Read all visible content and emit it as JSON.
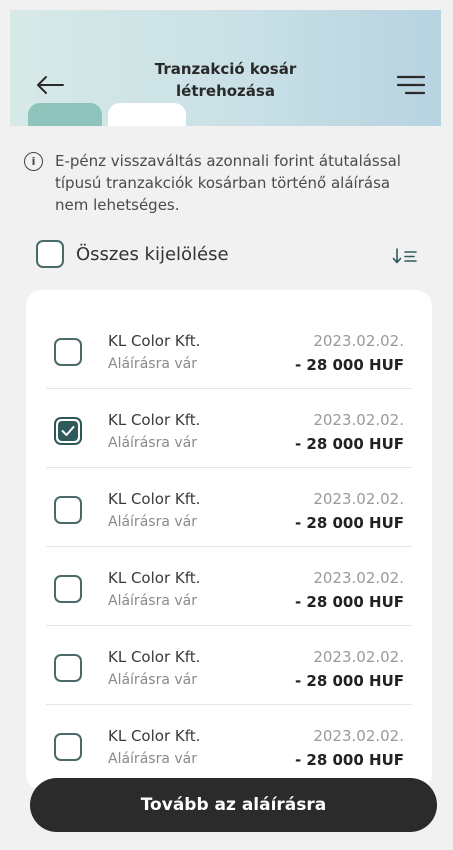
{
  "header": {
    "title_line1": "Tranzakció kosár",
    "title_line2": "létrehozása",
    "back_icon": "arrow-left-icon",
    "menu_icon": "hamburger-menu-icon"
  },
  "info": {
    "icon": "i",
    "text": "E-pénz visszaváltás azonnali forint átutalással típusú tranzakciók kosárban történő aláírása nem lehetséges."
  },
  "select_all": {
    "label": "Összes kijelölése",
    "checked": false
  },
  "sort_icon": "sort-icon",
  "transactions": [
    {
      "name": "KL Color Kft.",
      "status": "Aláírásra vár",
      "date": "2023.02.02.",
      "amount": "- 28 000 HUF",
      "checked": false
    },
    {
      "name": "KL Color Kft.",
      "status": "Aláírásra vár",
      "date": "2023.02.02.",
      "amount": "- 28 000 HUF",
      "checked": true
    },
    {
      "name": "KL Color Kft.",
      "status": "Aláírásra vár",
      "date": "2023.02.02.",
      "amount": "- 28 000 HUF",
      "checked": false
    },
    {
      "name": "KL Color Kft.",
      "status": "Aláírásra vár",
      "date": "2023.02.02.",
      "amount": "- 28 000 HUF",
      "checked": false
    },
    {
      "name": "KL Color Kft.",
      "status": "Aláírásra vár",
      "date": "2023.02.02.",
      "amount": "- 28 000 HUF",
      "checked": false
    },
    {
      "name": "KL Color Kft.",
      "status": "Aláírásra vár",
      "date": "2023.02.02.",
      "amount": "- 28 000 HUF",
      "checked": false
    }
  ],
  "cta": {
    "label": "Tovább az aláírásra"
  },
  "colors": {
    "accent": "#2f5a5a",
    "header_gradient_start": "#d7e9e7",
    "header_gradient_end": "#b6d3e0",
    "button_dark": "#2b2b2b"
  }
}
